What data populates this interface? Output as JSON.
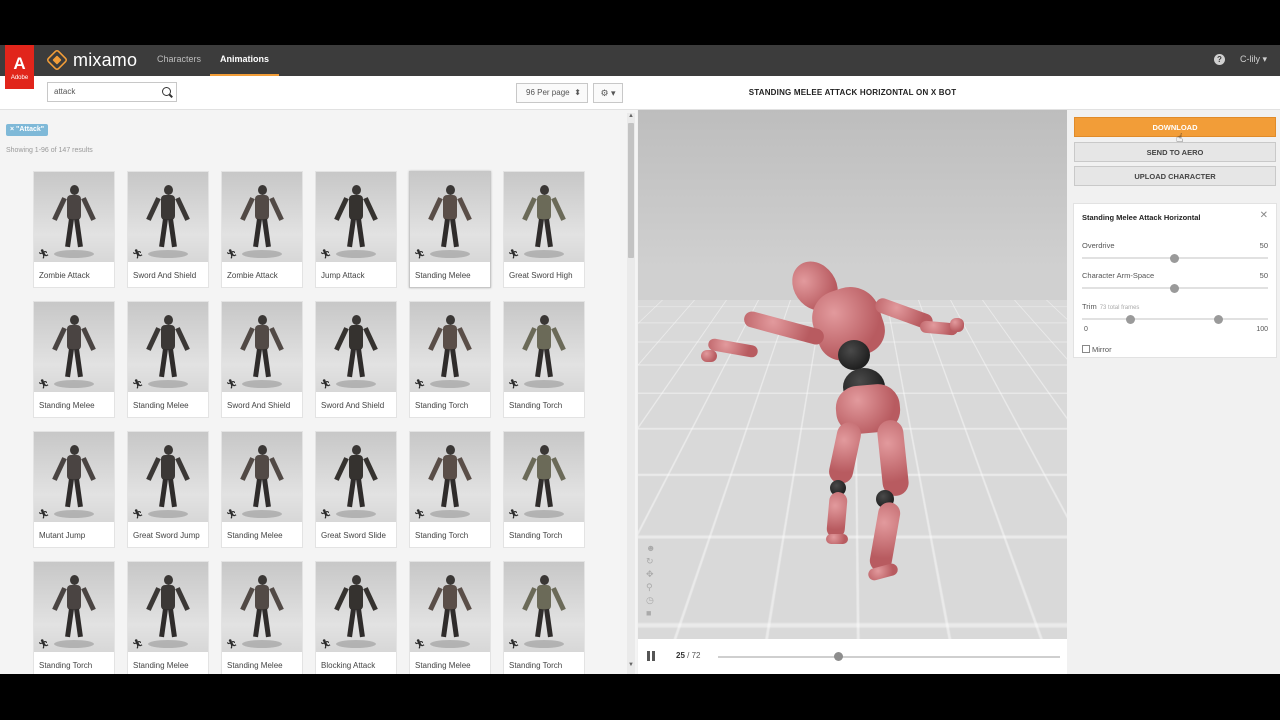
{
  "header": {
    "adobe_label": "Adobe",
    "brand": "mixamo",
    "tabs": [
      {
        "label": "Characters"
      },
      {
        "label": "Animations"
      }
    ],
    "help_label": "?",
    "user": "C-lily ▾"
  },
  "browser": {
    "search_value": "attack",
    "per_page": "96 Per page",
    "settings_label": "⚙ ▾",
    "tag": "× \"Attack\"",
    "results_text": "Showing 1-96 of 147 results",
    "cards": [
      {
        "label": "Zombie Attack"
      },
      {
        "label": "Sword And Shield"
      },
      {
        "label": "Zombie Attack"
      },
      {
        "label": "Jump Attack"
      },
      {
        "label": "Standing Melee"
      },
      {
        "label": "Great Sword High"
      },
      {
        "label": "Standing Melee"
      },
      {
        "label": "Standing Melee"
      },
      {
        "label": "Sword And Shield"
      },
      {
        "label": "Sword And Shield"
      },
      {
        "label": "Standing Torch"
      },
      {
        "label": "Standing Torch"
      },
      {
        "label": "Mutant Jump"
      },
      {
        "label": "Great Sword Jump"
      },
      {
        "label": "Standing Melee"
      },
      {
        "label": "Great Sword Slide"
      },
      {
        "label": "Standing Torch"
      },
      {
        "label": "Standing Torch"
      },
      {
        "label": "Standing Torch"
      },
      {
        "label": "Standing Melee"
      },
      {
        "label": "Standing Melee"
      },
      {
        "label": "Blocking Attack"
      },
      {
        "label": "Standing Melee"
      },
      {
        "label": "Standing Torch"
      }
    ],
    "selected_index": 4
  },
  "viewer": {
    "title": "STANDING MELEE ATTACK HORIZONTAL ON X BOT",
    "current_frame": "25",
    "total_frames": "/ 72",
    "playback_fraction": 0.35
  },
  "actions": {
    "download": "DOWNLOAD",
    "send_to_aero": "SEND TO AERO",
    "upload_character": "UPLOAD CHARACTER"
  },
  "settings": {
    "title": "Standing Melee Attack Horizontal",
    "close_label": "✕",
    "overdrive_label": "Overdrive",
    "overdrive_value": "50",
    "arm_space_label": "Character Arm-Space",
    "arm_space_value": "50",
    "trim_label": "Trim",
    "trim_note": "73 total frames",
    "trim_min": "0",
    "trim_max": "100",
    "mirror_label": "Mirror"
  },
  "colors": {
    "accent": "#f29d38",
    "nav_bg": "#3c3c3c",
    "adobe_red": "#e1251b",
    "tag_blue": "#7fb9d8"
  }
}
